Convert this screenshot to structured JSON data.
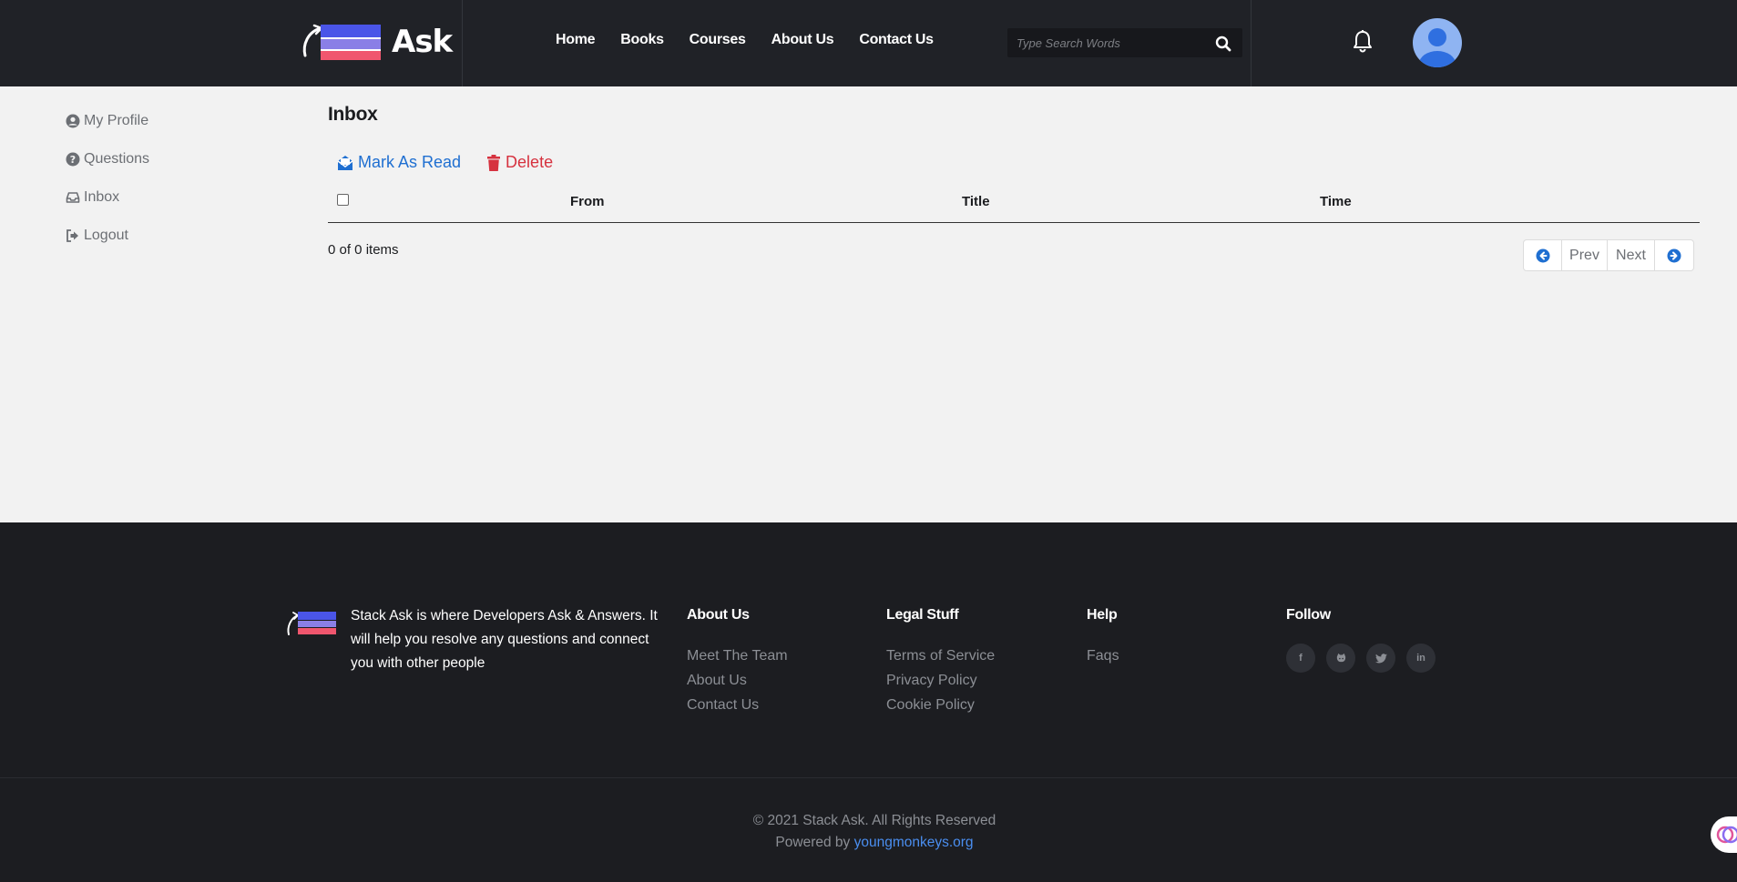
{
  "header": {
    "logo_text": "Ask",
    "nav": [
      "Home",
      "Books",
      "Courses",
      "About Us",
      "Contact Us"
    ],
    "search_placeholder": "Type Search Words"
  },
  "sidebar": {
    "items": [
      {
        "label": "My Profile",
        "icon": "user-circle-icon"
      },
      {
        "label": "Questions",
        "icon": "question-circle-icon"
      },
      {
        "label": "Inbox",
        "icon": "inbox-icon"
      },
      {
        "label": "Logout",
        "icon": "logout-icon"
      }
    ]
  },
  "main": {
    "title": "Inbox",
    "mark_read_label": "Mark As Read",
    "delete_label": "Delete",
    "columns": {
      "from": "From",
      "title": "Title",
      "time": "Time"
    },
    "count_text": "0 of 0 items",
    "pager": {
      "prev": "Prev",
      "next": "Next"
    }
  },
  "footer": {
    "about_text": "Stack Ask is where Developers Ask & Answers. It will help you resolve any questions and connect you with other people",
    "columns": [
      {
        "heading": "About Us",
        "links": [
          "Meet The Team",
          "About Us",
          "Contact Us"
        ]
      },
      {
        "heading": "Legal Stuff",
        "links": [
          "Terms of Service",
          "Privacy Policy",
          "Cookie Policy"
        ]
      },
      {
        "heading": "Help",
        "links": [
          "Faqs"
        ]
      }
    ],
    "follow_heading": "Follow",
    "social": [
      "facebook-icon",
      "github-icon",
      "twitter-icon",
      "linkedin-icon"
    ],
    "copyright": "© 2021 Stack Ask. All Rights Reserved",
    "powered_prefix": "Powered by",
    "powered_link": "youngmonkeys.org"
  },
  "colors": {
    "header_bg": "#202227",
    "footer_bg": "#1c1d21",
    "accent_blue": "#1f6fd1",
    "danger_red": "#d6323f",
    "logo_blue": "#4a55e8",
    "logo_red": "#f0566e"
  }
}
